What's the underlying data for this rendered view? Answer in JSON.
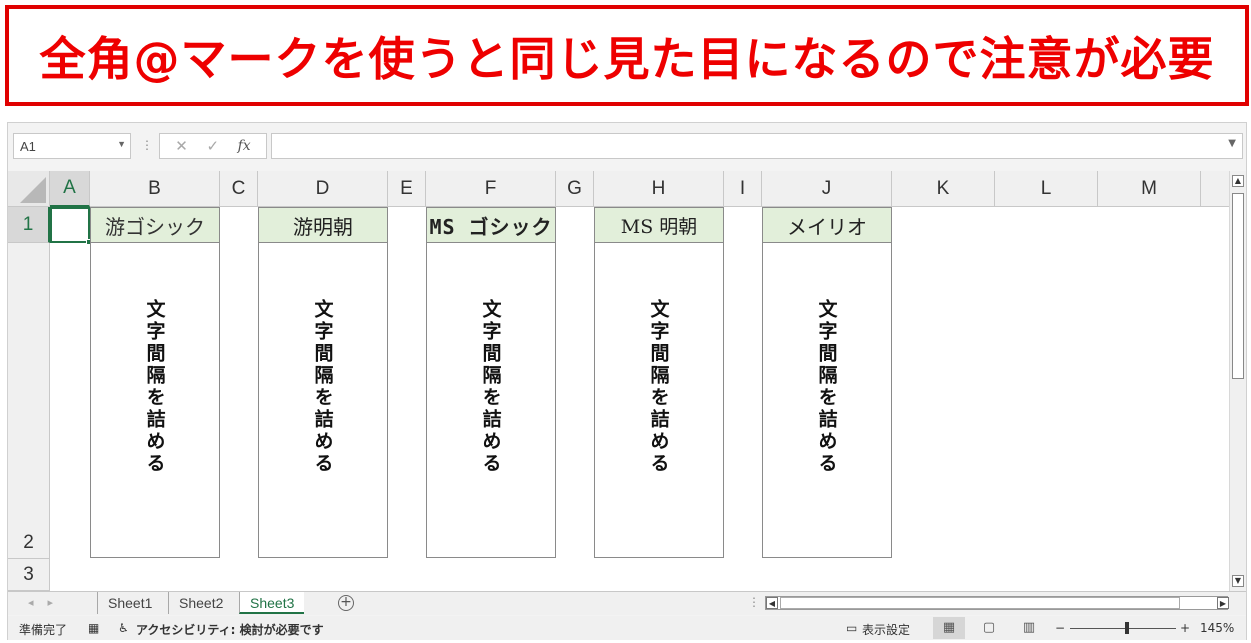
{
  "banner": {
    "title": "全角@マークを使うと同じ見た目になるので注意が必要"
  },
  "formula_bar": {
    "name_box": "A1",
    "cancel_icon": "close-icon",
    "enter_icon": "check-icon",
    "fx_label": "fx",
    "formula": ""
  },
  "columns": [
    "A",
    "B",
    "C",
    "D",
    "E",
    "F",
    "G",
    "H",
    "I",
    "J",
    "K",
    "L",
    "M"
  ],
  "rows": [
    "1",
    "2",
    "3"
  ],
  "font_samples": [
    {
      "column": "B",
      "font_name": "游ゴシック",
      "text": "文字間隔を詰める"
    },
    {
      "column": "D",
      "font_name": "游明朝",
      "text": "文字間隔を詰める"
    },
    {
      "column": "F",
      "font_name": "MS ゴシック",
      "text": "文字間隔を詰める"
    },
    {
      "column": "H",
      "font_name": "MS 明朝",
      "text": "文字間隔を詰める"
    },
    {
      "column": "J",
      "font_name": "メイリオ",
      "text": "文字間隔を詰める"
    }
  ],
  "sheet_tabs": [
    {
      "label": "Sheet1",
      "active": false
    },
    {
      "label": "Sheet2",
      "active": false
    },
    {
      "label": "Sheet3",
      "active": true
    }
  ],
  "status_bar": {
    "ready": "準備完了",
    "accessibility": "アクセシビリティ: 検討が必要です",
    "display_settings": "表示設定",
    "zoom_minus": "−",
    "zoom_plus": "+",
    "zoom": "145%"
  },
  "colors": {
    "banner_red": "#ee0000",
    "excel_green": "#217346",
    "header_fill": "#e2efda"
  }
}
